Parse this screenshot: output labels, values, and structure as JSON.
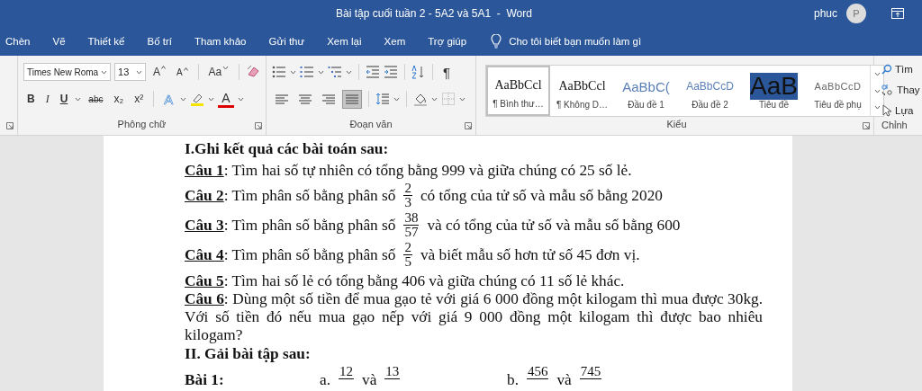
{
  "title_bar": {
    "title": "Bài tập cuối tuần 2 - 5A2 và 5A1  -  Word",
    "user": "phuc",
    "avatar": "P"
  },
  "ribbon_tabs": [
    {
      "label": "Chèn",
      "selected": false
    },
    {
      "label": "Vẽ",
      "selected": false
    },
    {
      "label": "Thiết kế",
      "selected": false
    },
    {
      "label": "Bố trí",
      "selected": false
    },
    {
      "label": "Tham khảo",
      "selected": false
    },
    {
      "label": "Gửi thư",
      "selected": false
    },
    {
      "label": "Xem lại",
      "selected": false
    },
    {
      "label": "Xem",
      "selected": false
    },
    {
      "label": "Trợ giúp",
      "selected": false
    }
  ],
  "tell_me": "Cho tôi biết bạn muốn làm gì",
  "font_group": {
    "label": "Phông chữ",
    "font_name": "Times New Roma",
    "font_size": "13",
    "grow": "A",
    "shrink": "A",
    "change_case": "Aa",
    "format_buttons": [
      {
        "label": "B",
        "kind": "bold"
      },
      {
        "label": "I",
        "kind": "italic"
      },
      {
        "label": "U",
        "kind": "underline"
      },
      {
        "label": "abc",
        "kind": "strike"
      },
      {
        "label": "x₂",
        "kind": "sub"
      },
      {
        "label": "x²",
        "kind": "sup"
      }
    ],
    "text_effect": "A",
    "font_color": "A"
  },
  "paragraph_group": {
    "label": "Đoạn văn",
    "pilcrow": "¶",
    "align_buttons": [
      {
        "kind": "left",
        "selected": false
      },
      {
        "kind": "center",
        "selected": false
      },
      {
        "kind": "right",
        "selected": false
      },
      {
        "kind": "justify",
        "selected": true
      }
    ]
  },
  "styles_group": {
    "label": "Kiểu",
    "styles": [
      {
        "preview": "AaBbCcl",
        "name": "¶ Bình thư…",
        "kind": "normal",
        "selected": true
      },
      {
        "preview": "AaBbCcl",
        "name": "¶ Không D…",
        "kind": "normal",
        "selected": false
      },
      {
        "preview": "AaBbC(",
        "name": "Đầu đề 1",
        "kind": "heading1",
        "selected": false
      },
      {
        "preview": "AaBbCcD",
        "name": "Đầu đề 2",
        "kind": "heading2",
        "selected": false
      },
      {
        "preview": "AaB",
        "name": "Tiêu đề",
        "kind": "title",
        "selected": false
      },
      {
        "preview": "AaBbCcD",
        "name": "Tiêu đề phụ",
        "kind": "subtitle",
        "selected": false
      }
    ]
  },
  "editing_group": {
    "label": "Chỉnh",
    "items": [
      {
        "label": "Tìm",
        "kind": "find"
      },
      {
        "label": "Thay",
        "kind": "replace"
      },
      {
        "label": "Lựa",
        "kind": "select"
      }
    ]
  },
  "document": {
    "heading_1": "I.Ghi kết quả các bài toán sau:",
    "questions": [
      {
        "parts": [
          {
            "kind": "text",
            "text": "**Câu 1**: Tìm hai số tự nhiên có tổng bằng 999 và giữa chúng có 25 số lẻ."
          }
        ]
      },
      {
        "parts": [
          {
            "kind": "text",
            "text": "**Câu 2**:  Tìm phân số bằng phân số"
          },
          {
            "kind": "fraction",
            "numerator": "2",
            "denominator": "3"
          },
          {
            "kind": "text",
            "text": "có tổng của tử số và mẫu số bằng 2020"
          }
        ]
      },
      {
        "parts": [
          {
            "kind": "text",
            "text": "**Câu 3**: Tìm phân số bằng phân số"
          },
          {
            "kind": "fraction",
            "numerator": "38",
            "denominator": "57"
          },
          {
            "kind": "text",
            "text": "và có tổng của tử số và mẫu số bằng 600"
          }
        ]
      },
      {
        "parts": [
          {
            "kind": "text",
            "text": "**Câu 4**: Tìm phân số bằng phân số"
          },
          {
            "kind": "fraction",
            "numerator": "2",
            "denominator": "5"
          },
          {
            "kind": "text",
            "text": "và biết mẫu số hơn tử số 45 đơn vị."
          }
        ]
      },
      {
        "parts": [
          {
            "kind": "text",
            "text": "**Câu 5**: Tìm hai số lẻ có tổng bằng 406 và giữa chúng có 11 số lẻ khác."
          }
        ]
      },
      {
        "parts": [
          {
            "kind": "text",
            "text": "**Câu 6**: Dùng một số tiền để mua gạo tẻ với giá 6 000 đồng một kilogam thì mua được 30kg. Với số tiền đó nếu mua gạo nếp với giá 9 000 đồng một kilogam thì được bao nhiêu kilogam?"
          }
        ]
      }
    ],
    "heading_2": "II. Gải bài tập sau:",
    "exercise": {
      "label": "Bài 1:",
      "items": [
        {
          "letter": "a.",
          "first": "12",
          "conj": "và",
          "second": "13"
        },
        {
          "letter": "b.",
          "first": "456",
          "conj": "và",
          "second": "745"
        }
      ]
    }
  }
}
